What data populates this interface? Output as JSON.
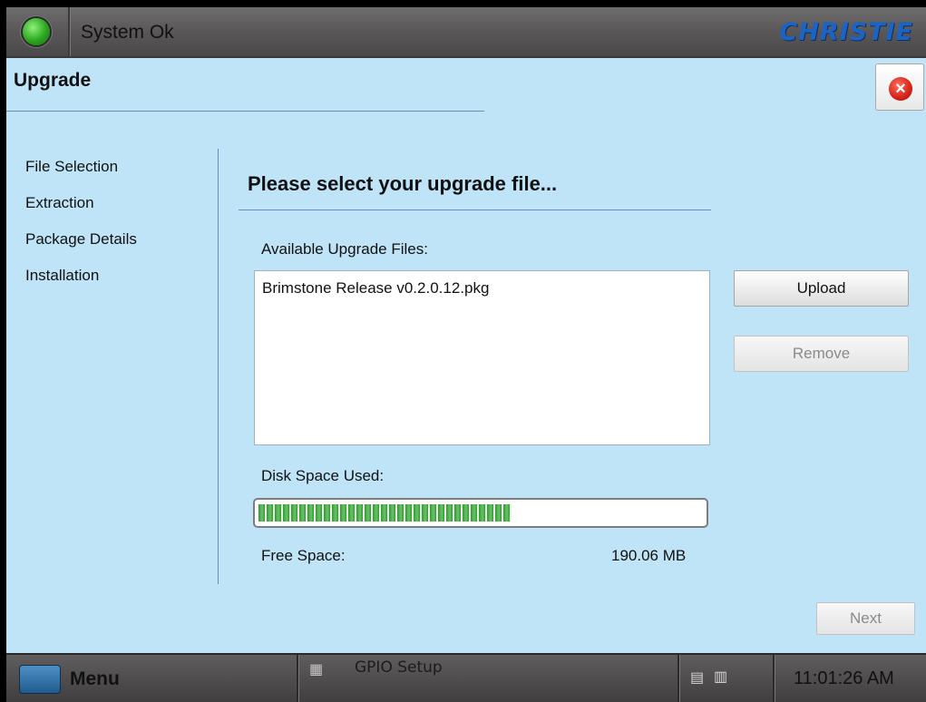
{
  "topbar": {
    "status_text": "System Ok",
    "status_color": "#2aa51f",
    "logo_text": "CHRISTIE"
  },
  "header": {
    "title": "Upgrade",
    "close_icon": "close-icon"
  },
  "steps": [
    "File Selection",
    "Extraction",
    "Package Details",
    "Installation"
  ],
  "main": {
    "heading": "Please select your upgrade file...",
    "files_label": "Available Upgrade Files:",
    "files": [
      "Brimstone Release v0.2.0.12.pkg"
    ],
    "upload_label": "Upload",
    "remove_label": "Remove",
    "disk_label": "Disk Space Used:",
    "disk_used_fraction": 0.57,
    "free_label": "Free Space:",
    "free_value": "190.06 MB",
    "next_label": "Next"
  },
  "taskbar": {
    "menu_label": "Menu",
    "gpio_label": "GPIO Setup",
    "clock": "11:01:26 AM"
  }
}
